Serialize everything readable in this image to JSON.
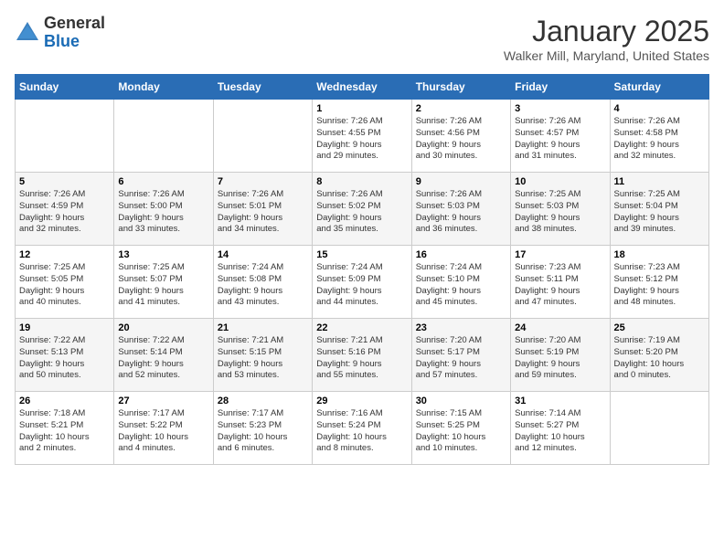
{
  "logo": {
    "general": "General",
    "blue": "Blue"
  },
  "title": "January 2025",
  "location": "Walker Mill, Maryland, United States",
  "days_of_week": [
    "Sunday",
    "Monday",
    "Tuesday",
    "Wednesday",
    "Thursday",
    "Friday",
    "Saturday"
  ],
  "weeks": [
    [
      {
        "day": "",
        "info": ""
      },
      {
        "day": "",
        "info": ""
      },
      {
        "day": "",
        "info": ""
      },
      {
        "day": "1",
        "info": "Sunrise: 7:26 AM\nSunset: 4:55 PM\nDaylight: 9 hours\nand 29 minutes."
      },
      {
        "day": "2",
        "info": "Sunrise: 7:26 AM\nSunset: 4:56 PM\nDaylight: 9 hours\nand 30 minutes."
      },
      {
        "day": "3",
        "info": "Sunrise: 7:26 AM\nSunset: 4:57 PM\nDaylight: 9 hours\nand 31 minutes."
      },
      {
        "day": "4",
        "info": "Sunrise: 7:26 AM\nSunset: 4:58 PM\nDaylight: 9 hours\nand 32 minutes."
      }
    ],
    [
      {
        "day": "5",
        "info": "Sunrise: 7:26 AM\nSunset: 4:59 PM\nDaylight: 9 hours\nand 32 minutes."
      },
      {
        "day": "6",
        "info": "Sunrise: 7:26 AM\nSunset: 5:00 PM\nDaylight: 9 hours\nand 33 minutes."
      },
      {
        "day": "7",
        "info": "Sunrise: 7:26 AM\nSunset: 5:01 PM\nDaylight: 9 hours\nand 34 minutes."
      },
      {
        "day": "8",
        "info": "Sunrise: 7:26 AM\nSunset: 5:02 PM\nDaylight: 9 hours\nand 35 minutes."
      },
      {
        "day": "9",
        "info": "Sunrise: 7:26 AM\nSunset: 5:03 PM\nDaylight: 9 hours\nand 36 minutes."
      },
      {
        "day": "10",
        "info": "Sunrise: 7:25 AM\nSunset: 5:03 PM\nDaylight: 9 hours\nand 38 minutes."
      },
      {
        "day": "11",
        "info": "Sunrise: 7:25 AM\nSunset: 5:04 PM\nDaylight: 9 hours\nand 39 minutes."
      }
    ],
    [
      {
        "day": "12",
        "info": "Sunrise: 7:25 AM\nSunset: 5:05 PM\nDaylight: 9 hours\nand 40 minutes."
      },
      {
        "day": "13",
        "info": "Sunrise: 7:25 AM\nSunset: 5:07 PM\nDaylight: 9 hours\nand 41 minutes."
      },
      {
        "day": "14",
        "info": "Sunrise: 7:24 AM\nSunset: 5:08 PM\nDaylight: 9 hours\nand 43 minutes."
      },
      {
        "day": "15",
        "info": "Sunrise: 7:24 AM\nSunset: 5:09 PM\nDaylight: 9 hours\nand 44 minutes."
      },
      {
        "day": "16",
        "info": "Sunrise: 7:24 AM\nSunset: 5:10 PM\nDaylight: 9 hours\nand 45 minutes."
      },
      {
        "day": "17",
        "info": "Sunrise: 7:23 AM\nSunset: 5:11 PM\nDaylight: 9 hours\nand 47 minutes."
      },
      {
        "day": "18",
        "info": "Sunrise: 7:23 AM\nSunset: 5:12 PM\nDaylight: 9 hours\nand 48 minutes."
      }
    ],
    [
      {
        "day": "19",
        "info": "Sunrise: 7:22 AM\nSunset: 5:13 PM\nDaylight: 9 hours\nand 50 minutes."
      },
      {
        "day": "20",
        "info": "Sunrise: 7:22 AM\nSunset: 5:14 PM\nDaylight: 9 hours\nand 52 minutes."
      },
      {
        "day": "21",
        "info": "Sunrise: 7:21 AM\nSunset: 5:15 PM\nDaylight: 9 hours\nand 53 minutes."
      },
      {
        "day": "22",
        "info": "Sunrise: 7:21 AM\nSunset: 5:16 PM\nDaylight: 9 hours\nand 55 minutes."
      },
      {
        "day": "23",
        "info": "Sunrise: 7:20 AM\nSunset: 5:17 PM\nDaylight: 9 hours\nand 57 minutes."
      },
      {
        "day": "24",
        "info": "Sunrise: 7:20 AM\nSunset: 5:19 PM\nDaylight: 9 hours\nand 59 minutes."
      },
      {
        "day": "25",
        "info": "Sunrise: 7:19 AM\nSunset: 5:20 PM\nDaylight: 10 hours\nand 0 minutes."
      }
    ],
    [
      {
        "day": "26",
        "info": "Sunrise: 7:18 AM\nSunset: 5:21 PM\nDaylight: 10 hours\nand 2 minutes."
      },
      {
        "day": "27",
        "info": "Sunrise: 7:17 AM\nSunset: 5:22 PM\nDaylight: 10 hours\nand 4 minutes."
      },
      {
        "day": "28",
        "info": "Sunrise: 7:17 AM\nSunset: 5:23 PM\nDaylight: 10 hours\nand 6 minutes."
      },
      {
        "day": "29",
        "info": "Sunrise: 7:16 AM\nSunset: 5:24 PM\nDaylight: 10 hours\nand 8 minutes."
      },
      {
        "day": "30",
        "info": "Sunrise: 7:15 AM\nSunset: 5:25 PM\nDaylight: 10 hours\nand 10 minutes."
      },
      {
        "day": "31",
        "info": "Sunrise: 7:14 AM\nSunset: 5:27 PM\nDaylight: 10 hours\nand 12 minutes."
      },
      {
        "day": "",
        "info": ""
      }
    ]
  ]
}
